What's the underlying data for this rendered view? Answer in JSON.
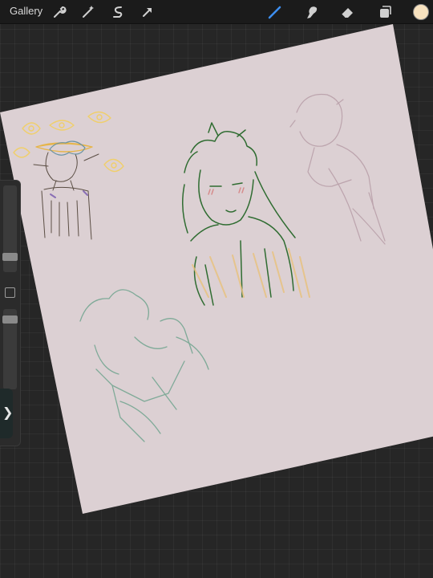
{
  "toolbar": {
    "gallery_label": "Gallery",
    "left_tools": [
      "wrench-icon",
      "magic-wand-icon",
      "selection-icon",
      "transform-arrow-icon"
    ],
    "right_tools": [
      "brush-icon",
      "smudge-icon",
      "eraser-icon",
      "layers-icon"
    ],
    "active_tool": "brush-icon",
    "current_color": "#f8e2bf"
  },
  "canvas": {
    "background": "#262626",
    "paper_color": "#dcd0d3",
    "sketch_colors": [
      "#f0cf6a",
      "#2f6c31",
      "#7faa98",
      "#bca4ad"
    ]
  },
  "sidebar": {
    "brush_size_slider": 0.12,
    "opacity_slider": 0.1
  },
  "undo_tab": {
    "glyph": "❯"
  }
}
